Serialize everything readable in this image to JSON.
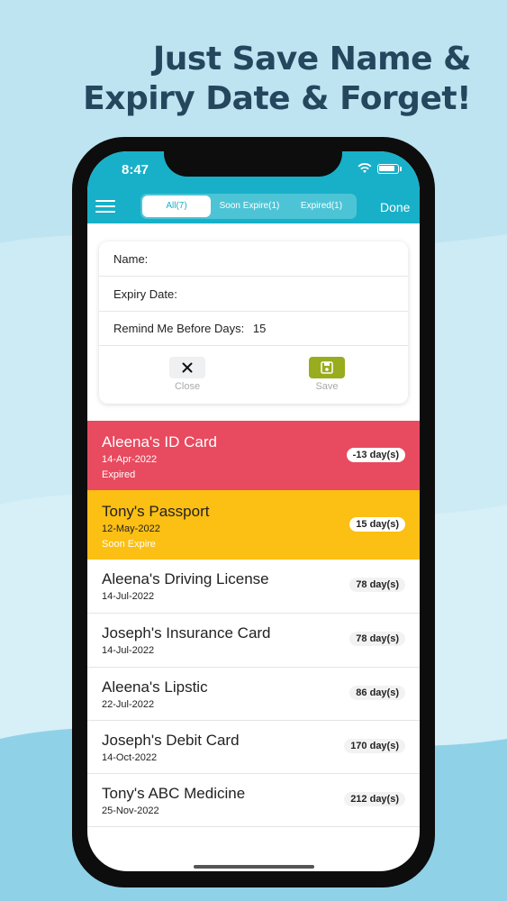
{
  "headline": {
    "line1": "Just Save Name &",
    "line2": "Expiry Date & Forget!"
  },
  "status_bar": {
    "time": "8:47"
  },
  "nav": {
    "tabs": [
      {
        "label": "All(7)",
        "active": true
      },
      {
        "label": "Soon Expire(1)",
        "active": false
      },
      {
        "label": "Expired(1)",
        "active": false
      }
    ],
    "done_label": "Done"
  },
  "form": {
    "name_label": "Name:",
    "expiry_label": "Expiry Date:",
    "remind_label": "Remind Me Before Days:",
    "remind_value": "15",
    "close_label": "Close",
    "save_label": "Save"
  },
  "items": [
    {
      "name": "Aleena's ID Card",
      "date": "14-Apr-2022",
      "status": "Expired",
      "days": "-13 day(s)"
    },
    {
      "name": "Tony's Passport",
      "date": "12-May-2022",
      "status": "Soon Expire",
      "days": "15 day(s)"
    },
    {
      "name": "Aleena's Driving License",
      "date": "14-Jul-2022",
      "status": "",
      "days": "78 day(s)"
    },
    {
      "name": "Joseph's Insurance Card",
      "date": "14-Jul-2022",
      "status": "",
      "days": "78 day(s)"
    },
    {
      "name": "Aleena's Lipstic",
      "date": "22-Jul-2022",
      "status": "",
      "days": "86 day(s)"
    },
    {
      "name": "Joseph's Debit Card",
      "date": "14-Oct-2022",
      "status": "",
      "days": "170 day(s)"
    },
    {
      "name": "Tony's ABC Medicine",
      "date": "25-Nov-2022",
      "status": "",
      "days": "212 day(s)"
    }
  ],
  "colors": {
    "accent": "#17b0c8",
    "expired": "#e84a5f",
    "soon_expire": "#fcbf13",
    "headline": "#24475e",
    "save_button": "#98ac1e"
  }
}
